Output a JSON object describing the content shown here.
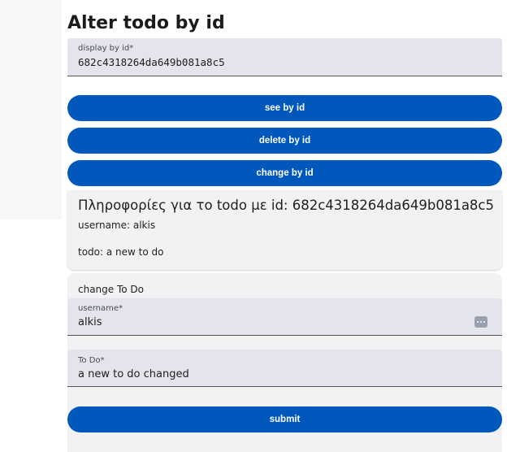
{
  "page": {
    "title": "Alter todo by id"
  },
  "id_field": {
    "label": "display by id*",
    "value": "682c4318264da649b081a8c5"
  },
  "actions": {
    "see_label": "see by id",
    "delete_label": "delete by id",
    "change_label": "change by id"
  },
  "info": {
    "title": "Πληροφορίες για το todo με id: 682c4318264da649b081a8c5",
    "username": "username: alkis",
    "todo": "todo: a new to do"
  },
  "change_form": {
    "heading": "change To Do",
    "username_label": "username*",
    "username_value": "alkis",
    "username_icon": "more-horizontal-icon",
    "todo_label": "To Do*",
    "todo_value": "a new to do changed",
    "submit_label": "submit"
  },
  "colors": {
    "primary": "#0058bd",
    "field_bg": "#e3e4ec",
    "card_bg": "#f2f2f4"
  }
}
